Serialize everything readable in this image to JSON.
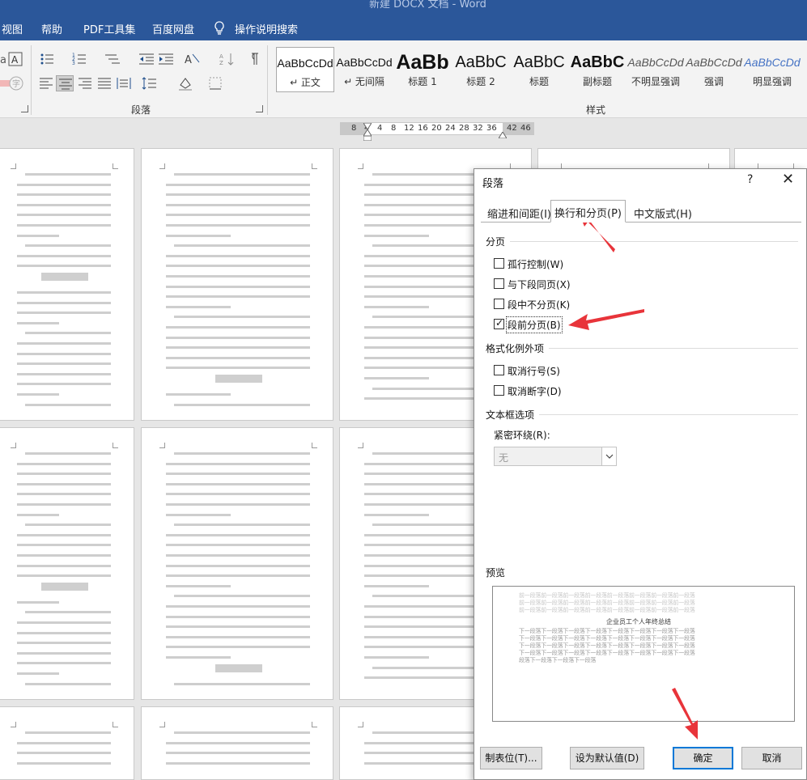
{
  "window": {
    "title": "新建 DOCX 文档 - Word"
  },
  "menu": [
    "视图",
    "帮助",
    "PDF工具集",
    "百度网盘"
  ],
  "tell_me": {
    "label": "操作说明搜索",
    "icon": "lightbulb-icon"
  },
  "ribbon": {
    "groups": {
      "paragraph": "段落",
      "styles": "样式"
    },
    "styles": [
      {
        "sample": "AaBbCcDd",
        "name": "↵ 正文",
        "selected": true
      },
      {
        "sample": "AaBbCcDd",
        "name": "↵ 无间隔"
      },
      {
        "sample": "AaBb",
        "name": "标题 1"
      },
      {
        "sample": "AaBbC",
        "name": "标题 2"
      },
      {
        "sample": "AaBbC",
        "name": "标题"
      },
      {
        "sample": "AaBbC",
        "name": "副标题"
      },
      {
        "sample": "AaBbCcDd",
        "name": "不明显强调"
      },
      {
        "sample": "AaBbCcDd",
        "name": "强调"
      },
      {
        "sample": "AaBbCcDd",
        "name": "明显强调"
      }
    ]
  },
  "ruler": {
    "numbers": [
      "8",
      "4",
      "4",
      "8",
      "12",
      "16",
      "20",
      "24",
      "28",
      "32",
      "36",
      "42",
      "46"
    ]
  },
  "dialog": {
    "title": "段落",
    "help": "?",
    "close": "✕",
    "tabs": [
      "缩进和间距(I)",
      "换行和分页(P)",
      "中文版式(H)"
    ],
    "active_tab": 1,
    "pagination": {
      "label": "分页",
      "options": [
        {
          "label": "孤行控制(W)",
          "checked": false
        },
        {
          "label": "与下段同页(X)",
          "checked": false
        },
        {
          "label": "段中不分页(K)",
          "checked": false
        },
        {
          "label": "段前分页(B)",
          "checked": true
        }
      ]
    },
    "exceptions": {
      "label": "格式化例外项",
      "options": [
        {
          "label": "取消行号(S)",
          "checked": false
        },
        {
          "label": "取消断字(D)",
          "checked": false
        }
      ]
    },
    "textbox": {
      "label": "文本框选项",
      "tight_wrap_label": "紧密环绕(R):",
      "tight_wrap_value": "无"
    },
    "preview": {
      "label": "预览",
      "before_line": "前一段落前一段落前一段落前一段落前一段落前一段落前一段落前一段落",
      "main_text": "企业员工个人年终总结",
      "after_line": "下一段落下一段落下一段落下一段落下一段落下一段落下一段落下一段落",
      "after_last": "段落下一段落下一段落下一段落"
    },
    "buttons": {
      "tabs": "制表位(T)...",
      "default": "设为默认值(D)",
      "ok": "确定",
      "cancel": "取消"
    }
  },
  "document": {
    "heading": "企业员工个人年终总结"
  },
  "colors": {
    "word_blue": "#2b579a",
    "focus_blue": "#0078d7",
    "annotation_red": "#e8343a"
  }
}
